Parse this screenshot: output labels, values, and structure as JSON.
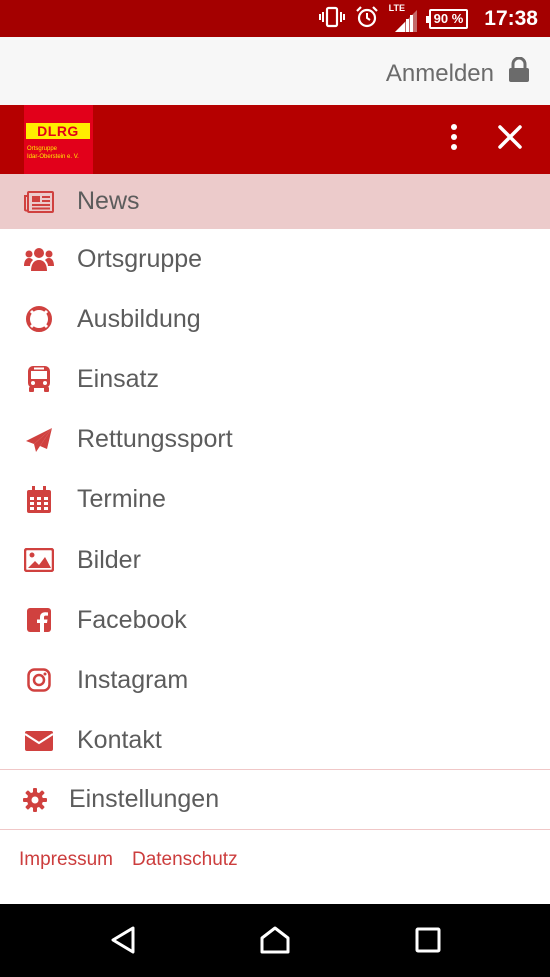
{
  "status_bar": {
    "network": "LTE",
    "battery": "90 %",
    "time": "17:38"
  },
  "top_bar": {
    "login_label": "Anmelden"
  },
  "logo": {
    "badge": "DLRG",
    "line1": "Ortsgruppe",
    "line2": "Idar-Oberstein e. V."
  },
  "nav": {
    "items": [
      {
        "label": "News",
        "icon": "newspaper-icon"
      },
      {
        "label": "Ortsgruppe",
        "icon": "users-icon"
      },
      {
        "label": "Ausbildung",
        "icon": "lifebuoy-icon"
      },
      {
        "label": "Einsatz",
        "icon": "bus-icon"
      },
      {
        "label": "Rettungssport",
        "icon": "paper-plane-icon"
      },
      {
        "label": "Termine",
        "icon": "calendar-icon"
      },
      {
        "label": "Bilder",
        "icon": "image-icon"
      },
      {
        "label": "Facebook",
        "icon": "facebook-icon"
      },
      {
        "label": "Instagram",
        "icon": "instagram-icon"
      },
      {
        "label": "Kontakt",
        "icon": "envelope-icon"
      }
    ],
    "active_index": 0
  },
  "settings": {
    "label": "Einstellungen"
  },
  "footer": {
    "impressum": "Impressum",
    "datenschutz": "Datenschutz"
  },
  "colors": {
    "status_bar": "#a40000",
    "header": "#b50000",
    "accent": "#d0413f",
    "active_bg": "#eccbcb",
    "logo_red": "#e2001a",
    "logo_yellow": "#ffed00"
  }
}
